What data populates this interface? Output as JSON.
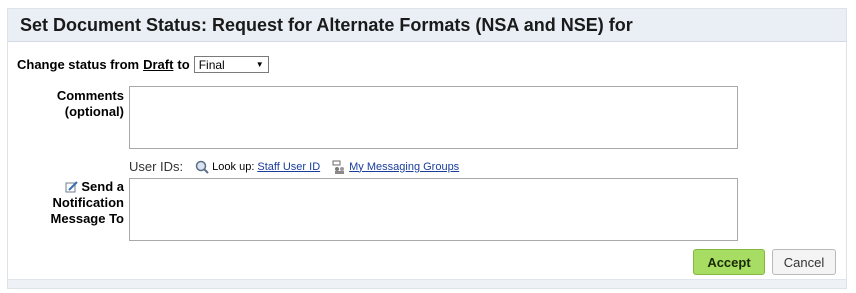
{
  "dialog": {
    "title": "Set Document Status: Request for Alternate Formats (NSA and NSE) for"
  },
  "status": {
    "prefix": "Change status from",
    "from": "Draft",
    "to_word": "to",
    "selected": "Final"
  },
  "comments": {
    "label_line1": "Comments",
    "label_line2": "(optional)",
    "value": ""
  },
  "notification": {
    "label": "Send a Notification Message To",
    "user_ids_label": "User IDs:",
    "lookup_text": "Look up:",
    "staff_link": "Staff User ID",
    "groups_link": "My Messaging Groups",
    "value": ""
  },
  "buttons": {
    "accept": "Accept",
    "cancel": "Cancel"
  },
  "colors": {
    "accept_bg": "#a7dd62",
    "title_bar_bg": "#e9eff5",
    "link": "#1a3d9c"
  }
}
